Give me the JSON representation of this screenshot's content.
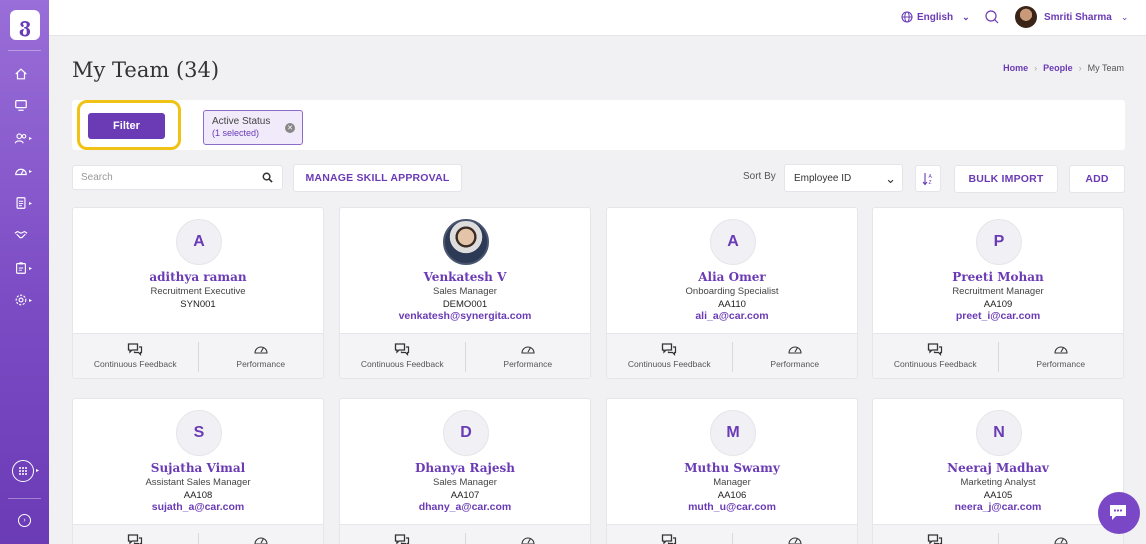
{
  "app": {
    "logo_letter": "ვ"
  },
  "topbar": {
    "language": "English",
    "user_name": "Smriti Sharma"
  },
  "page": {
    "title": "My Team (34)"
  },
  "breadcrumb": {
    "home": "Home",
    "people": "People",
    "current": "My Team"
  },
  "filter": {
    "button_label": "Filter",
    "chip_title": "Active Status",
    "chip_subtitle": "(1 selected)"
  },
  "toolbar": {
    "search_placeholder": "Search",
    "manage_skill_label": "MANAGE SKILL APPROVAL",
    "sort_by_label": "Sort By",
    "sort_value": "Employee ID",
    "bulk_import_label": "BULK IMPORT",
    "add_label": "ADD"
  },
  "card_footer": {
    "feedback_label": "Continuous Feedback",
    "performance_label": "Performance"
  },
  "employees": [
    {
      "initial": "A",
      "name": "adithya raman",
      "designation": "Recruitment Executive",
      "emp_id": "SYN001",
      "email": ""
    },
    {
      "initial": "",
      "name": "Venkatesh V",
      "designation": "Sales Manager",
      "emp_id": "DEMO001",
      "email": "venkatesh@synergita.com",
      "photo": true
    },
    {
      "initial": "A",
      "name": "Alia Omer",
      "designation": "Onboarding Specialist",
      "emp_id": "AA110",
      "email": "ali_a@car.com"
    },
    {
      "initial": "P",
      "name": "Preeti Mohan",
      "designation": "Recruitment Manager",
      "emp_id": "AA109",
      "email": "preet_i@car.com"
    },
    {
      "initial": "S",
      "name": "Sujatha Vimal",
      "designation": "Assistant Sales Manager",
      "emp_id": "AA108",
      "email": "sujath_a@car.com"
    },
    {
      "initial": "D",
      "name": "Dhanya Rajesh",
      "designation": "Sales Manager",
      "emp_id": "AA107",
      "email": "dhany_a@car.com"
    },
    {
      "initial": "M",
      "name": "Muthu Swamy",
      "designation": "Manager",
      "emp_id": "AA106",
      "email": "muth_u@car.com"
    },
    {
      "initial": "N",
      "name": "Neeraj Madhav",
      "designation": "Marketing Analyst",
      "emp_id": "AA105",
      "email": "neera_j@car.com"
    }
  ],
  "colors": {
    "accent": "#6a3bb5",
    "highlight": "#f1c216",
    "background": "#f1f1f3"
  }
}
